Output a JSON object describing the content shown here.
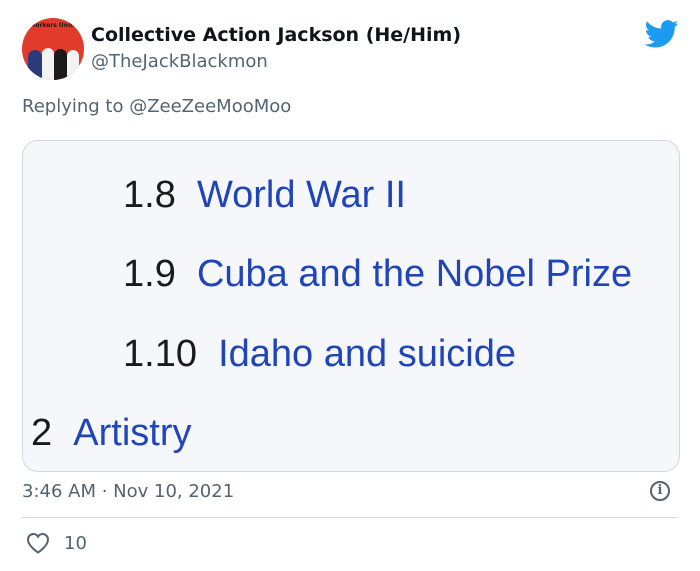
{
  "tweet": {
    "display_name": "Collective Action Jackson (He/Him)",
    "handle": "@TheJackBlackmon",
    "avatar_text": "Workers Unite",
    "replying_prefix": "Replying to ",
    "replying_to": "@ZeeZeeMooMoo",
    "timestamp": "3:46 AM · Nov 10, 2021",
    "like_count": "10"
  },
  "media": {
    "entries": [
      {
        "number": "1.8",
        "title": "World War II"
      },
      {
        "number": "1.9",
        "title": "Cuba and the Nobel Prize"
      },
      {
        "number": "1.10",
        "title": "Idaho and suicide"
      },
      {
        "number": "2",
        "title": "Artistry"
      }
    ]
  },
  "colors": {
    "brand_blue": "#1d9bf0",
    "link_blue": "#1f45b8",
    "muted_text": "#536471",
    "avatar_red": "#e23a2b"
  },
  "icons": {
    "logo": "twitter-bird-icon",
    "info": "info-icon",
    "like": "heart-icon"
  }
}
